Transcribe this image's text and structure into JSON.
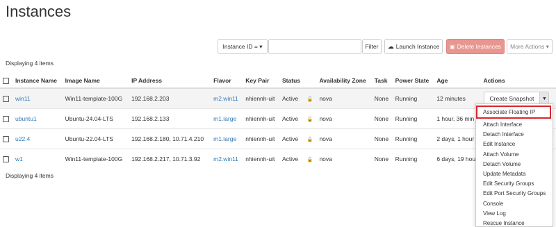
{
  "page": {
    "title": "Instances"
  },
  "toolbar": {
    "filter_field": "Instance ID = ▾",
    "filter_button": "Filter",
    "launch": "Launch Instance",
    "delete": "Delete Instances",
    "more": "More Actions ▾"
  },
  "display_count": "Displaying 4 items",
  "columns": [
    "Instance Name",
    "Image Name",
    "IP Address",
    "Flavor",
    "Key Pair",
    "Status",
    "Availability Zone",
    "Task",
    "Power State",
    "Age",
    "Actions"
  ],
  "rows": [
    {
      "name": "win11",
      "image": "Win11-template-100G",
      "ip": "192.168.2.203",
      "flavor": "m2.win11",
      "keypair": "nhiennh-uit",
      "status": "Active",
      "zone": "nova",
      "task": "None",
      "power": "Running",
      "age": "12 minutes"
    },
    {
      "name": "ubuntu1",
      "image": "Ubuntu-24.04-LTS",
      "ip": "192.168.2.133",
      "flavor": "m1.large",
      "keypair": "nhiennh-uit",
      "status": "Active",
      "zone": "nova",
      "task": "None",
      "power": "Running",
      "age": "1 hour, 36 min"
    },
    {
      "name": "u22.4",
      "image": "Ubuntu-22.04-LTS",
      "ip": "192.168.2.180, 10.71.4.210",
      "flavor": "m1.large",
      "keypair": "nhiennh-uit",
      "status": "Active",
      "zone": "nova",
      "task": "None",
      "power": "Running",
      "age": "2 days, 1 hour"
    },
    {
      "name": "w1",
      "image": "Win11-template-100G",
      "ip": "192.168.2.217, 10.71.3.92",
      "flavor": "m2.win11",
      "keypair": "nhiennh-uit",
      "status": "Active",
      "zone": "nova",
      "task": "None",
      "power": "Running",
      "age": "6 days, 19 hou"
    }
  ],
  "snapshot_button": "Create Snapshot",
  "dropdown": [
    "Associate Floating IP",
    "Attach Interface",
    "Detach Interface",
    "Edit Instance",
    "Attach Volume",
    "Detach Volume",
    "Update Metadata",
    "Edit Security Groups",
    "Edit Port Security Groups",
    "Console",
    "View Log",
    "Rescue Instance"
  ]
}
